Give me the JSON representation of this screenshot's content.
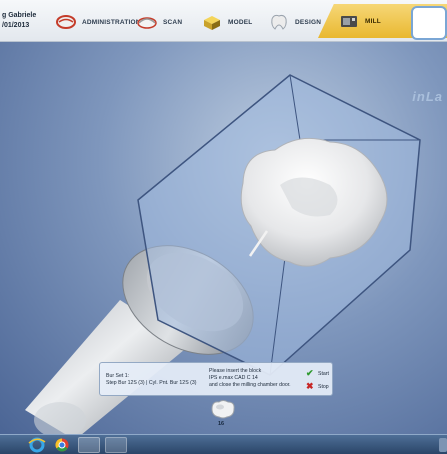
{
  "patient": {
    "name": "g Gabriele",
    "date": "/01/2013"
  },
  "workflow": {
    "steps": [
      {
        "label": "ADMINISTRATION",
        "icon": "administration-tooth-icon"
      },
      {
        "label": "SCAN",
        "icon": "scan-jaw-icon"
      },
      {
        "label": "MODEL",
        "icon": "model-cube-icon"
      },
      {
        "label": "DESIGN",
        "icon": "design-tooth-icon"
      },
      {
        "label": "MILL",
        "icon": "mill-machine-icon",
        "active": true
      }
    ]
  },
  "brand": "inLa",
  "mill_panel": {
    "bur_set_title": "Bur Set 1:",
    "bur_set_detail": "Step Bur 12S (3)  |  Cyl. Pnt. Bur 12S (3)",
    "message_line1": "Please insert the block",
    "message_line2": "IPS e.max CAD C 14",
    "message_line3": "and close the milling chamber door.",
    "start_label": "Start",
    "stop_label": "Stop"
  },
  "block_indicator": {
    "number": "16",
    "icon": "restoration-block-icon"
  },
  "taskbar": {
    "items": [
      "start-orb-icon",
      "internet-explorer-icon",
      "chrome-icon",
      "cerec-app-icon",
      "sirona-app-icon"
    ]
  },
  "colors": {
    "accent": "#e9b830",
    "background": "#6f89b3",
    "start_green": "#2f9a2f",
    "stop_red": "#c72626"
  }
}
